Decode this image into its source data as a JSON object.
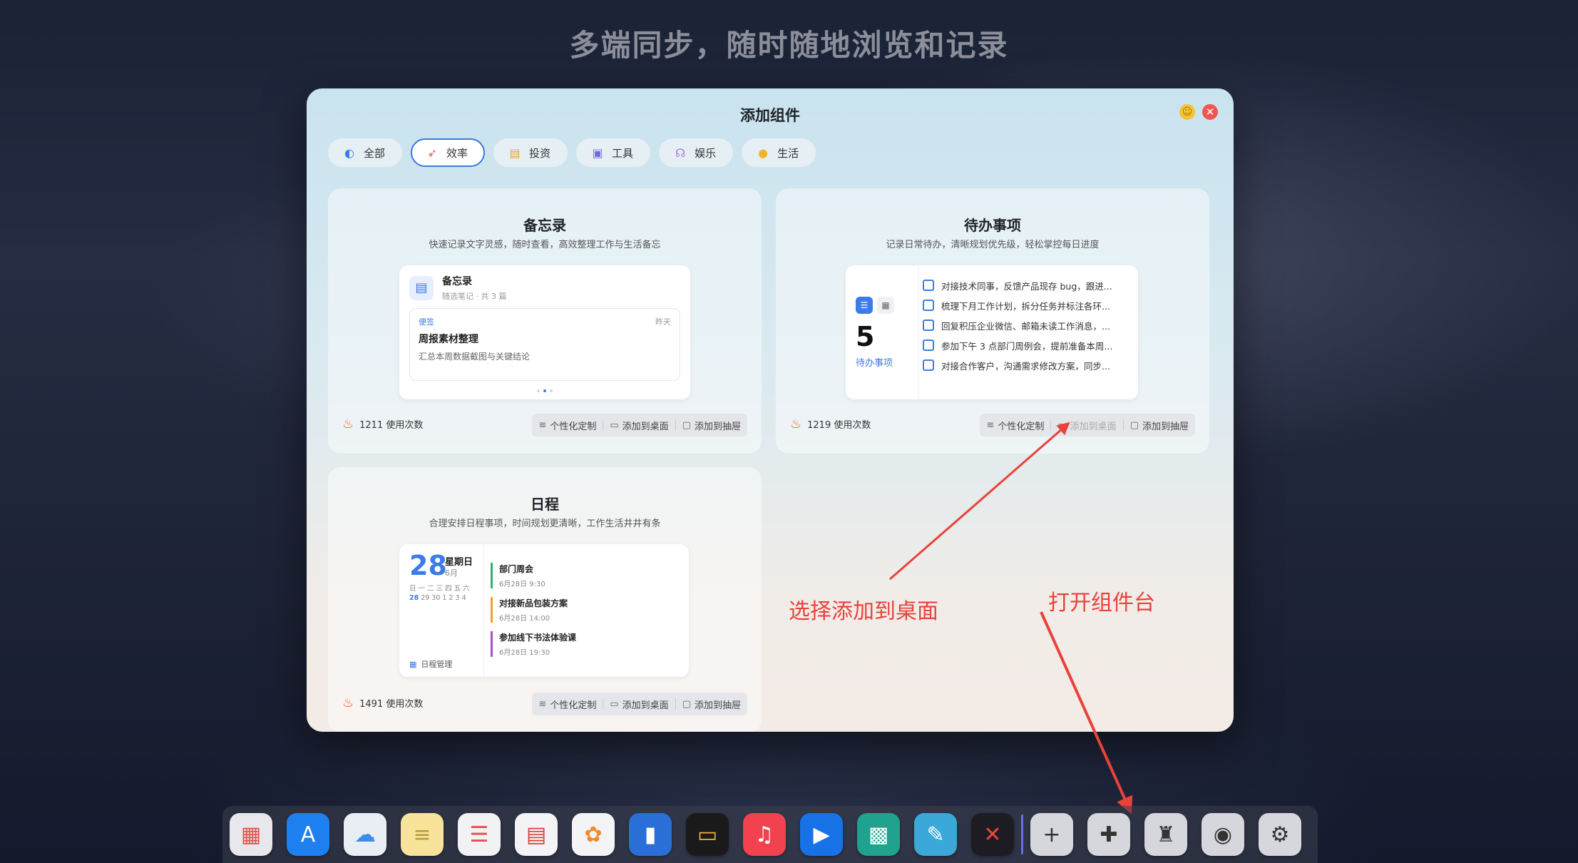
{
  "headline": "多端同步，随时随地浏览和记录",
  "dialog": {
    "title": "添加组件",
    "min_glyph": "☺",
    "close_glyph": "✕"
  },
  "tabs": [
    {
      "label": "全部",
      "icon": "all-icon"
    },
    {
      "label": "效率",
      "icon": "rocket-icon",
      "active": true
    },
    {
      "label": "投资",
      "icon": "invest-icon"
    },
    {
      "label": "工具",
      "icon": "toolbox-icon"
    },
    {
      "label": "娱乐",
      "icon": "headphones-icon"
    },
    {
      "label": "生活",
      "icon": "bulb-icon"
    }
  ],
  "actions": {
    "customize": "个性化定制",
    "add_desktop": "添加到桌面",
    "add_drawer": "添加到抽屉"
  },
  "cards": {
    "memo": {
      "title": "备忘录",
      "desc": "快速记录文字灵感，随时查看，高效整理工作与生活备忘",
      "usage": "1211 使用次数",
      "preview": {
        "name": "备忘录",
        "sub": "随选笔记 · 共 3 篇",
        "tag": "便签",
        "date": "昨天",
        "note_title": "周报素材整理",
        "note_desc": "汇总本周数据截图与关键结论"
      }
    },
    "todo": {
      "title": "待办事项",
      "desc": "记录日常待办，清晰规划优先级，轻松掌控每日进度",
      "usage": "1219 使用次数",
      "preview": {
        "count": "5",
        "count_label": "待办事项",
        "items": [
          "对接技术同事，反馈产品现存 bug，跟进...",
          "梳理下月工作计划，拆分任务并标注各环...",
          "回复积压企业微信、邮箱未读工作消息，...",
          "参加下午 3 点部门周例会，提前准备本周...",
          "对接合作客户，沟通需求修改方案，同步..."
        ]
      }
    },
    "schedule": {
      "title": "日程",
      "desc": "合理安排日程事项，时间规划更清晰，工作生活井井有条",
      "usage": "1491 使用次数",
      "preview": {
        "day": "28",
        "weekday": "星期日",
        "month": "6月",
        "week_header": [
          "日",
          "一",
          "二",
          "三",
          "四",
          "五",
          "六"
        ],
        "week_days": [
          "28",
          "29",
          "30",
          "1",
          "2",
          "3",
          "4"
        ],
        "manager": "日程管理",
        "events": [
          {
            "title": "部门周会",
            "time": "6月28日 9:30",
            "color": "#2fb36a"
          },
          {
            "title": "对接新品包装方案",
            "time": "6月28日 14:00",
            "color": "#f0a02a"
          },
          {
            "title": "参加线下书法体验课",
            "time": "6月28日 19:30",
            "color": "#a64fd6"
          }
        ]
      }
    }
  },
  "annotations": {
    "add_to_desktop": "选择添加到桌面",
    "open_widget_bar": "打开组件台"
  },
  "dock": [
    {
      "name": "launchpad-icon",
      "bg": "#e8e8ec",
      "glyph": "▦",
      "color": "#e0524a"
    },
    {
      "name": "app-store-icon",
      "bg": "#1e7ff0",
      "glyph": "A"
    },
    {
      "name": "icloud-icon",
      "bg": "#e9eef5",
      "glyph": "☁",
      "color": "#3b8de8"
    },
    {
      "name": "notes-icon",
      "bg": "#f7e39a",
      "glyph": "≡",
      "color": "#b89a3a"
    },
    {
      "name": "reminders-icon",
      "bg": "#f2f2f4",
      "glyph": "☰",
      "color": "#e0524a"
    },
    {
      "name": "calendar-icon",
      "bg": "#f4f4f6",
      "glyph": "▤",
      "color": "#d8413a"
    },
    {
      "name": "photos-icon",
      "bg": "#f4f4f6",
      "glyph": "✿",
      "color": "#f08a2a"
    },
    {
      "name": "files-icon",
      "bg": "#2a6fd8",
      "glyph": "▮"
    },
    {
      "name": "wallet-icon",
      "bg": "#1a1a1a",
      "glyph": "▭",
      "color": "#f2b33a"
    },
    {
      "name": "music-icon",
      "bg": "#f2424f",
      "glyph": "♫"
    },
    {
      "name": "player-icon",
      "bg": "#1672e6",
      "glyph": "▶"
    },
    {
      "name": "qr-code-icon",
      "bg": "#1fa38f",
      "glyph": "▩"
    },
    {
      "name": "drawing-icon",
      "bg": "#3aa8d8",
      "glyph": "✎"
    },
    {
      "name": "mindmap-icon",
      "bg": "#1c1c22",
      "glyph": "✕",
      "color": "#e8483a"
    },
    {
      "separator": true
    },
    {
      "name": "add-icon",
      "bg": "#d6d7dc",
      "glyph": "+",
      "color": "#333"
    },
    {
      "name": "widget-puzzle-icon",
      "bg": "#d6d7dc",
      "glyph": "✚",
      "color": "#333"
    },
    {
      "name": "brush-icon",
      "bg": "#d6d7dc",
      "glyph": "♜",
      "color": "#333"
    },
    {
      "name": "lock-settings-icon",
      "bg": "#d6d7dc",
      "glyph": "◉",
      "color": "#333"
    },
    {
      "name": "system-settings-icon",
      "bg": "#d6d7dc",
      "glyph": "⚙",
      "color": "#333"
    }
  ]
}
